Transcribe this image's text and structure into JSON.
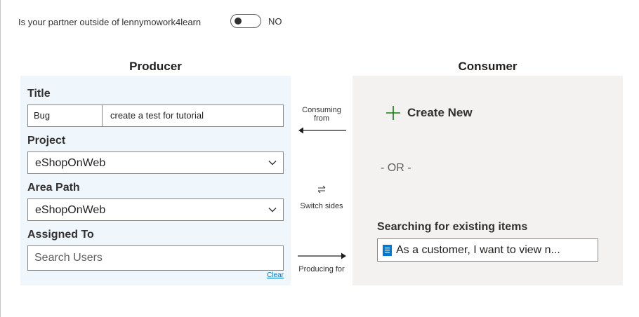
{
  "partner_question": {
    "label": "Is your partner outside of lennymowork4learn",
    "toggle_state": "NO"
  },
  "producer": {
    "heading": "Producer",
    "title_label": "Title",
    "title_type": "Bug",
    "title_text": "create a test for tutorial",
    "project_label": "Project",
    "project_value": "eShopOnWeb",
    "area_path_label": "Area Path",
    "area_path_value": "eShopOnWeb",
    "assigned_to_label": "Assigned To",
    "assigned_to_placeholder": "Search Users",
    "clear_label": "Clear"
  },
  "middle": {
    "consuming_label": "Consuming from",
    "switch_label": "Switch sides",
    "producing_label": "Producing for"
  },
  "consumer": {
    "heading": "Consumer",
    "create_new_label": "Create New",
    "or_text": "- OR -",
    "search_heading": "Searching for existing items",
    "search_result": "As a customer, I want to view n..."
  },
  "colors": {
    "producer_panel_bg": "#eff6fc",
    "consumer_panel_bg": "#f3f2f1",
    "link": "#0078d4",
    "plus_icon": "#107c10",
    "doc_icon": "#0078d4"
  },
  "icons": [
    "toggle-switch",
    "chevron-down-icon",
    "arrow-left-icon",
    "switch-sides-icon",
    "arrow-right-icon",
    "plus-icon",
    "document-icon"
  ]
}
